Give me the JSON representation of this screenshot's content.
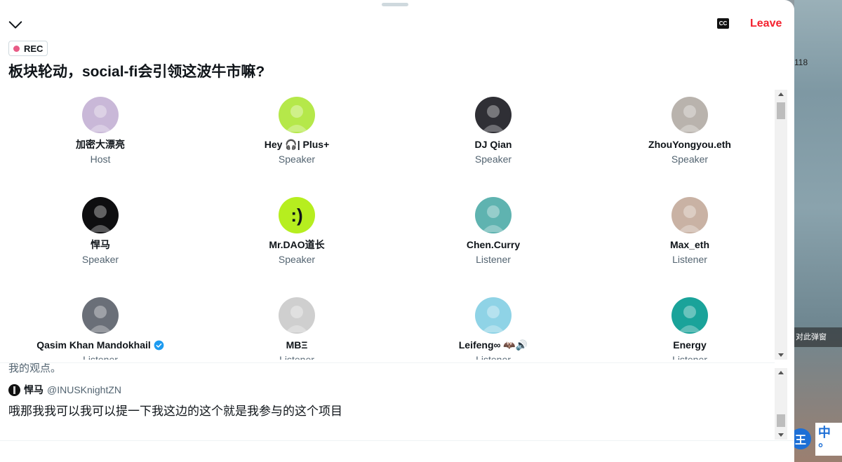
{
  "header": {
    "cc_label": "CC",
    "leave_label": "Leave",
    "rec_label": "REC"
  },
  "space": {
    "title": "板块轮动，social-fi会引领这波牛市嘛?"
  },
  "participants": [
    {
      "name": "加密大漂亮",
      "role": "Host",
      "avatar_color": "#c9b8d8",
      "avatar_glyph": ""
    },
    {
      "name": "Hey 🎧| Plus+",
      "role": "Speaker",
      "avatar_color": "#b5e84a",
      "avatar_glyph": ""
    },
    {
      "name": "DJ Qian",
      "role": "Speaker",
      "avatar_color": "#2f2f35",
      "avatar_glyph": ""
    },
    {
      "name": "ZhouYongyou.eth",
      "role": "Speaker",
      "avatar_color": "#b9b3ad",
      "avatar_glyph": ""
    },
    {
      "name": "悍马",
      "role": "Speaker",
      "avatar_color": "#0e0e10",
      "avatar_glyph": ""
    },
    {
      "name": "Mr.DAO道长",
      "role": "Speaker",
      "avatar_color": "#b6ee1f",
      "avatar_glyph": ":)"
    },
    {
      "name": "Chen.Curry",
      "role": "Listener",
      "avatar_color": "#5fb3b0",
      "avatar_glyph": ""
    },
    {
      "name": "Max_eth",
      "role": "Listener",
      "avatar_color": "#c9b2a4",
      "avatar_glyph": ""
    },
    {
      "name": "Qasim Khan Mandokhail",
      "role": "Listener",
      "avatar_color": "#6a6f78",
      "avatar_glyph": "",
      "verified": true
    },
    {
      "name": "MBΞ",
      "role": "Listener",
      "avatar_color": "#cfcfcf",
      "avatar_glyph": ""
    },
    {
      "name": "Leifeng∞ 🦇🔊",
      "role": "Listener",
      "avatar_color": "#8fd3e6",
      "avatar_glyph": ""
    },
    {
      "name": "Energy",
      "role": "Listener",
      "avatar_color": "#1aa39a",
      "avatar_glyph": ""
    }
  ],
  "transcript": {
    "previous_line": "我的观点。",
    "speaker_name": "悍马",
    "speaker_handle": "@INUSKnightZN",
    "caption": "哦那我我可以我可以提一下我这边的这个就是我参与的这个项目"
  },
  "desktop": {
    "number_text": "118",
    "bar_text": "对此弹窗"
  },
  "ime": {
    "badge": "王",
    "text": "中 °"
  },
  "colors": {
    "leave": "#f4212e",
    "rec_dot": "#e0245e",
    "verified": "#1d9bf0"
  }
}
